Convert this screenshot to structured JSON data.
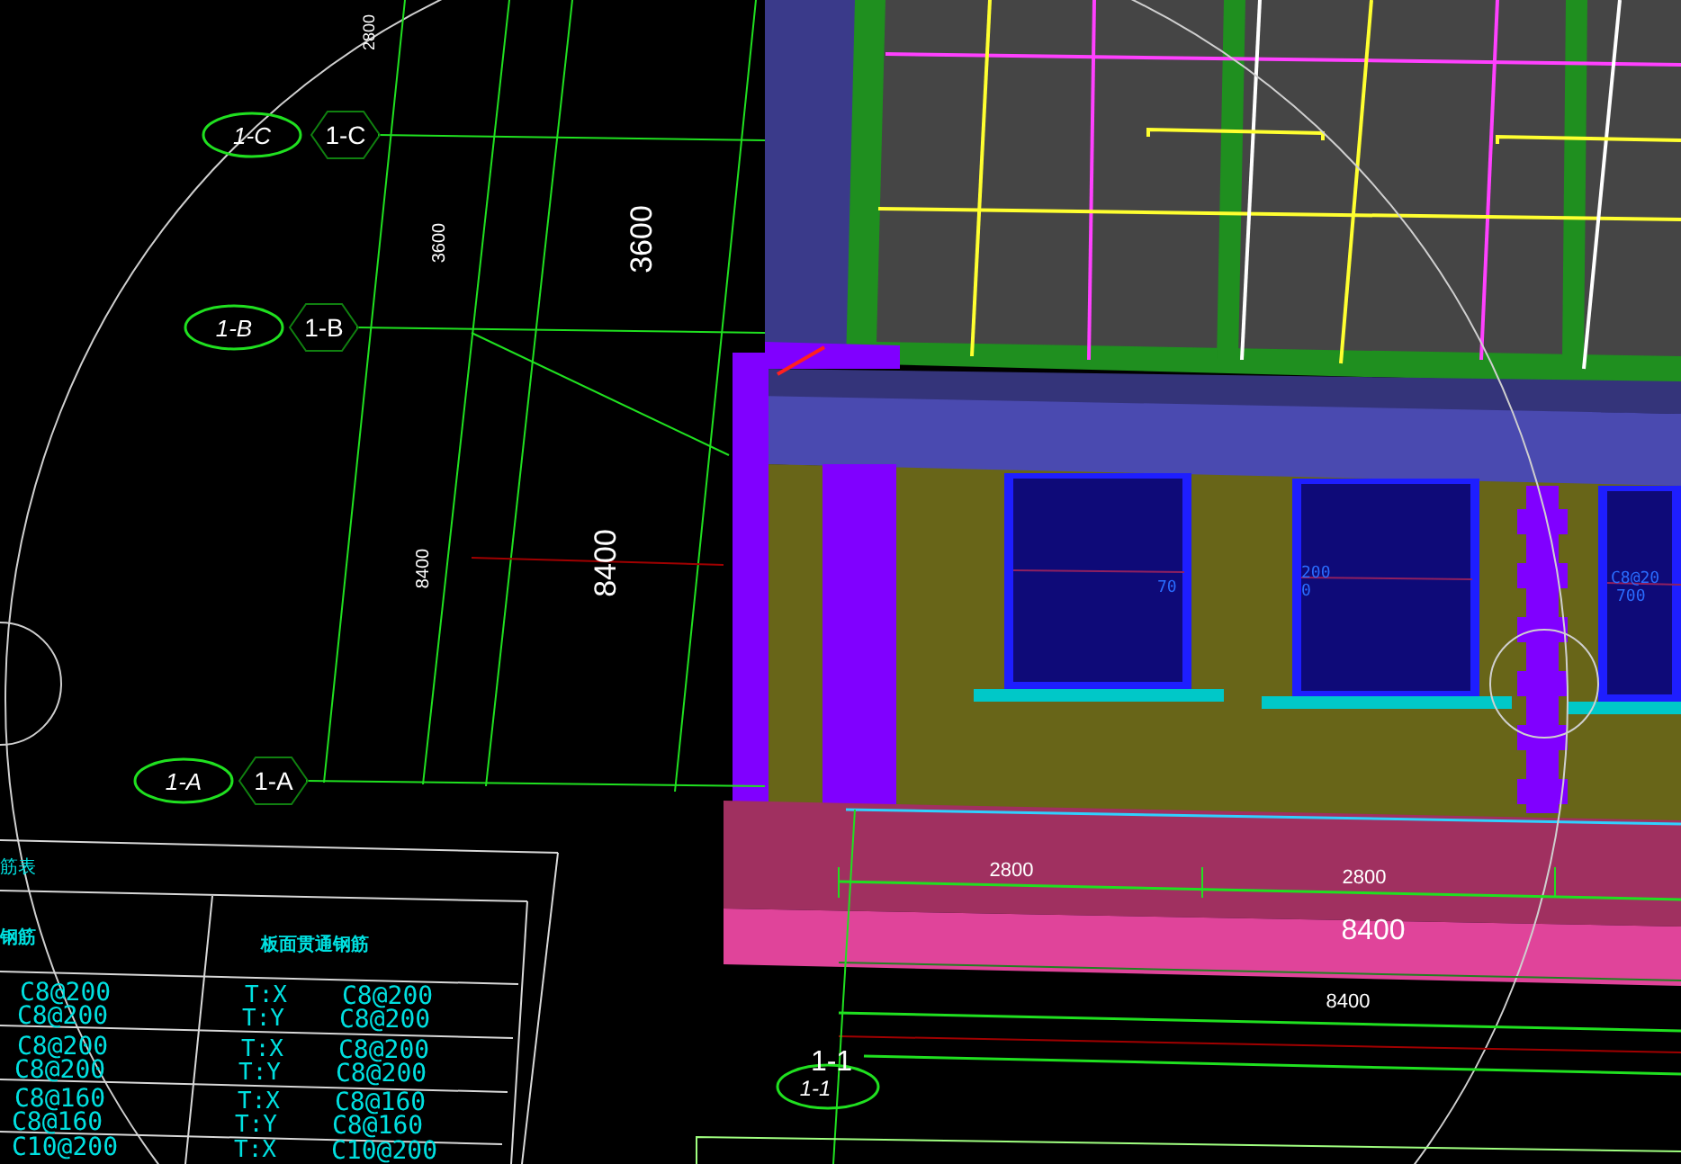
{
  "axes": [
    {
      "bubble": "1-C",
      "label": "1-C"
    },
    {
      "bubble": "1-B",
      "label": "1-B"
    },
    {
      "bubble": "1-A",
      "label": "1-A"
    }
  ],
  "vertical_dimensions": [
    "2800",
    "3600",
    "3600",
    "8400",
    "8400"
  ],
  "window_annotations": [
    "70",
    "200",
    "0",
    "C8@20",
    "700"
  ],
  "bottom_dimensions": [
    "2800",
    "2800",
    "8400",
    "8400"
  ],
  "section_marker": {
    "label": "1-1",
    "bubble": "1-1"
  },
  "table": {
    "title": "筋表",
    "headers": [
      "钢筋",
      "板面贯通钢筋"
    ],
    "rows": [
      {
        "left": [
          "C8@200",
          "C8@200"
        ],
        "top": [
          {
            "label": "T:X",
            "value": "C8@200"
          },
          {
            "label": "T:Y",
            "value": "C8@200"
          }
        ]
      },
      {
        "left": [
          "C8@200",
          "C8@200"
        ],
        "top": [
          {
            "label": "T:X",
            "value": "C8@200"
          },
          {
            "label": "T:Y",
            "value": "C8@200"
          }
        ]
      },
      {
        "left": [
          "C8@160",
          "C8@160"
        ],
        "top": [
          {
            "label": "T:X",
            "value": "C8@160"
          },
          {
            "label": "T:Y",
            "value": "C8@160"
          }
        ]
      },
      {
        "left": [
          "C10@200"
        ],
        "top": [
          {
            "label": "T:X",
            "value": "C10@200"
          }
        ]
      }
    ]
  }
}
